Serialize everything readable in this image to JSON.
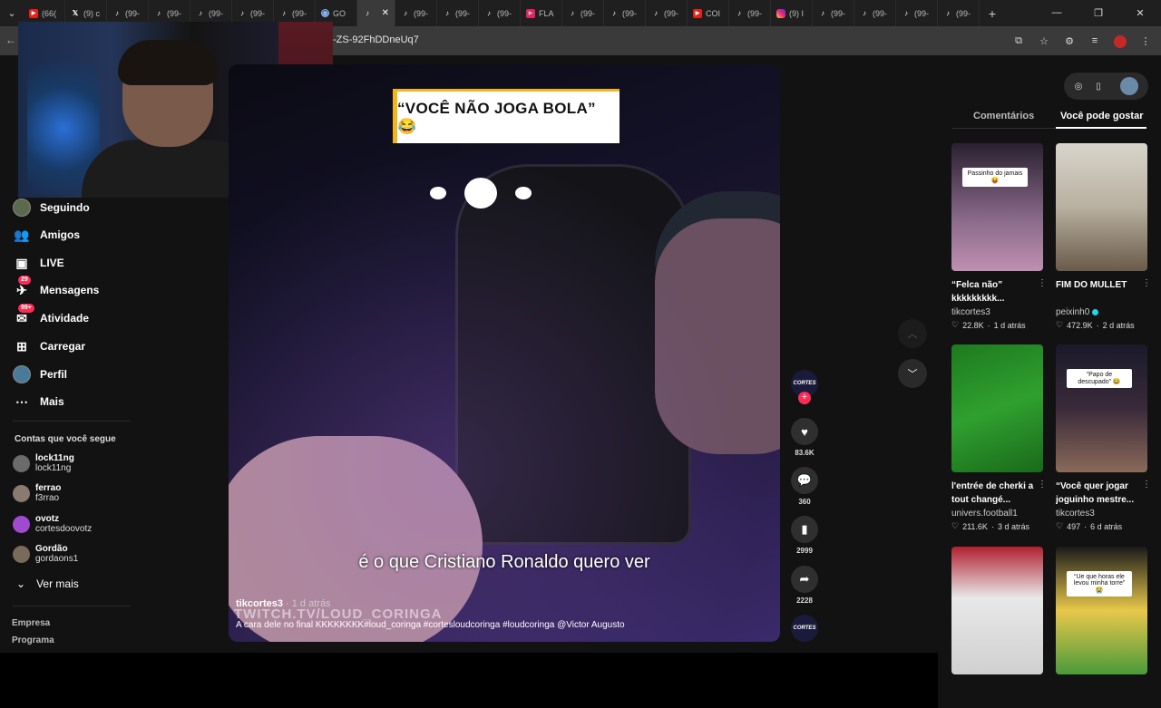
{
  "browser": {
    "tabs": [
      {
        "icon": "yt",
        "label": "(66("
      },
      {
        "icon": "x",
        "label": "(9) c"
      },
      {
        "icon": "tiktok",
        "label": "(99-"
      },
      {
        "icon": "tiktok",
        "label": "(99-"
      },
      {
        "icon": "tiktok",
        "label": "(99-"
      },
      {
        "icon": "tiktok",
        "label": "(99-"
      },
      {
        "icon": "tiktok",
        "label": "(99-"
      },
      {
        "icon": "globe",
        "label": "GO"
      },
      {
        "icon": "tiktok",
        "label": "",
        "active": true
      },
      {
        "icon": "tiktok",
        "label": "(99-"
      },
      {
        "icon": "tiktok",
        "label": "(99-"
      },
      {
        "icon": "tiktok",
        "label": "(99-"
      },
      {
        "icon": "flag",
        "label": "FLA"
      },
      {
        "icon": "tiktok",
        "label": "(99-"
      },
      {
        "icon": "tiktok",
        "label": "(99-"
      },
      {
        "icon": "tiktok",
        "label": "(99-"
      },
      {
        "icon": "yt",
        "label": "COI"
      },
      {
        "icon": "tiktok",
        "label": "(99-"
      },
      {
        "icon": "insta",
        "label": "(9) I"
      },
      {
        "icon": "tiktok",
        "label": "(99-"
      },
      {
        "icon": "tiktok",
        "label": "(99-"
      },
      {
        "icon": "tiktok",
        "label": "(99-"
      },
      {
        "icon": "tiktok",
        "label": "(99-"
      }
    ],
    "url": "-ZS-92FhDDneUq7"
  },
  "sidebar": {
    "nav": [
      {
        "key": "following",
        "label": "Seguindo",
        "icon": "following-avatar-icon"
      },
      {
        "key": "friends",
        "label": "Amigos",
        "icon": "friends-icon"
      },
      {
        "key": "live",
        "label": "LIVE",
        "icon": "live-icon"
      },
      {
        "key": "messages",
        "label": "Mensagens",
        "icon": "messages-icon",
        "badge": "29"
      },
      {
        "key": "activity",
        "label": "Atividade",
        "icon": "activity-icon",
        "badge": "99+"
      },
      {
        "key": "upload",
        "label": "Carregar",
        "icon": "upload-icon"
      },
      {
        "key": "profile",
        "label": "Perfil",
        "icon": "profile-avatar-icon"
      },
      {
        "key": "more",
        "label": "Mais",
        "icon": "more-dots-icon"
      }
    ],
    "following_title": "Contas que você segue",
    "accounts": [
      {
        "name": "lock11ng",
        "handle": "lock11ng",
        "color": "#6b6b6b"
      },
      {
        "name": "ferrao",
        "handle": "f3rrao",
        "color": "#8a7a70"
      },
      {
        "name": "ovotz",
        "handle": "cortesdoovotz",
        "color": "#a04ad0"
      },
      {
        "name": "Gordão",
        "handle": "gordaons1",
        "color": "#7a6a5a"
      }
    ],
    "see_more": "Ver mais",
    "footer": [
      "Empresa",
      "Programa"
    ]
  },
  "video": {
    "caption_box": "“VOCÊ NÃO JOGA BOLA” 😂",
    "subtitle": "é o que Cristiano Ronaldo quero ver",
    "watermark": "TWITCH.TV/LOUD_CORINGA",
    "author": "tikcortes3",
    "time": " · 1 d atrás",
    "description": "A cara dele no final KKKKKKKK#loud_coringa #cortesloudcoringa #loudcoringa @Victor Augusto"
  },
  "actions": {
    "creator_label": "CORTES",
    "likes": "83.6K",
    "comments": "360",
    "saves": "2999",
    "shares": "2228"
  },
  "right_panel": {
    "tabs": [
      "Comentários",
      "Você pode gostar"
    ],
    "cards": [
      {
        "title": "“Felca não” kkkkkkkkk...",
        "author": "tikcortes3",
        "verified": false,
        "likes": "22.8K",
        "time": "1 d atrás",
        "overlay": "Passinho do jamais 😝",
        "bg": "linear-gradient(180deg,#2a2030,#8a6a8a 60%,#c090b0)"
      },
      {
        "title": "FIM DO MULLET",
        "author": "peixinh0",
        "verified": true,
        "likes": "472.9K",
        "time": "2 d atrás",
        "overlay": "",
        "bg": "linear-gradient(180deg,#d9d5cc,#b8b0a0 50%,#6a5a4a)"
      },
      {
        "title": "l'entrée de cherki a tout changé...",
        "author": "univers.football1",
        "verified": false,
        "likes": "211.6K",
        "time": "3 d atrás",
        "overlay": "",
        "bg": "linear-gradient(160deg,#1e7a1e,#2fa02f 50%,#1a6a1a)"
      },
      {
        "title": "“Você quer jogar joguinho mestre...",
        "author": "tikcortes3",
        "verified": false,
        "likes": "497",
        "time": "6 d atrás",
        "overlay": "“Papo de descupado” 😂",
        "bg": "linear-gradient(180deg,#1a1a2a,#3a2a3a 50%,#8a6a5a)"
      },
      {
        "title": "",
        "author": "",
        "verified": false,
        "likes": "",
        "time": "",
        "overlay": "",
        "bg": "linear-gradient(180deg,#b02030,#e8e8e8 40%,#d0d0d0)"
      },
      {
        "title": "",
        "author": "",
        "verified": false,
        "likes": "",
        "time": "",
        "overlay": "“Ue que horas ele levou minha torre” 😭",
        "bg": "linear-gradient(180deg,#1a1a1a,#e8c84a 50%,#4a9a3a)"
      }
    ]
  }
}
